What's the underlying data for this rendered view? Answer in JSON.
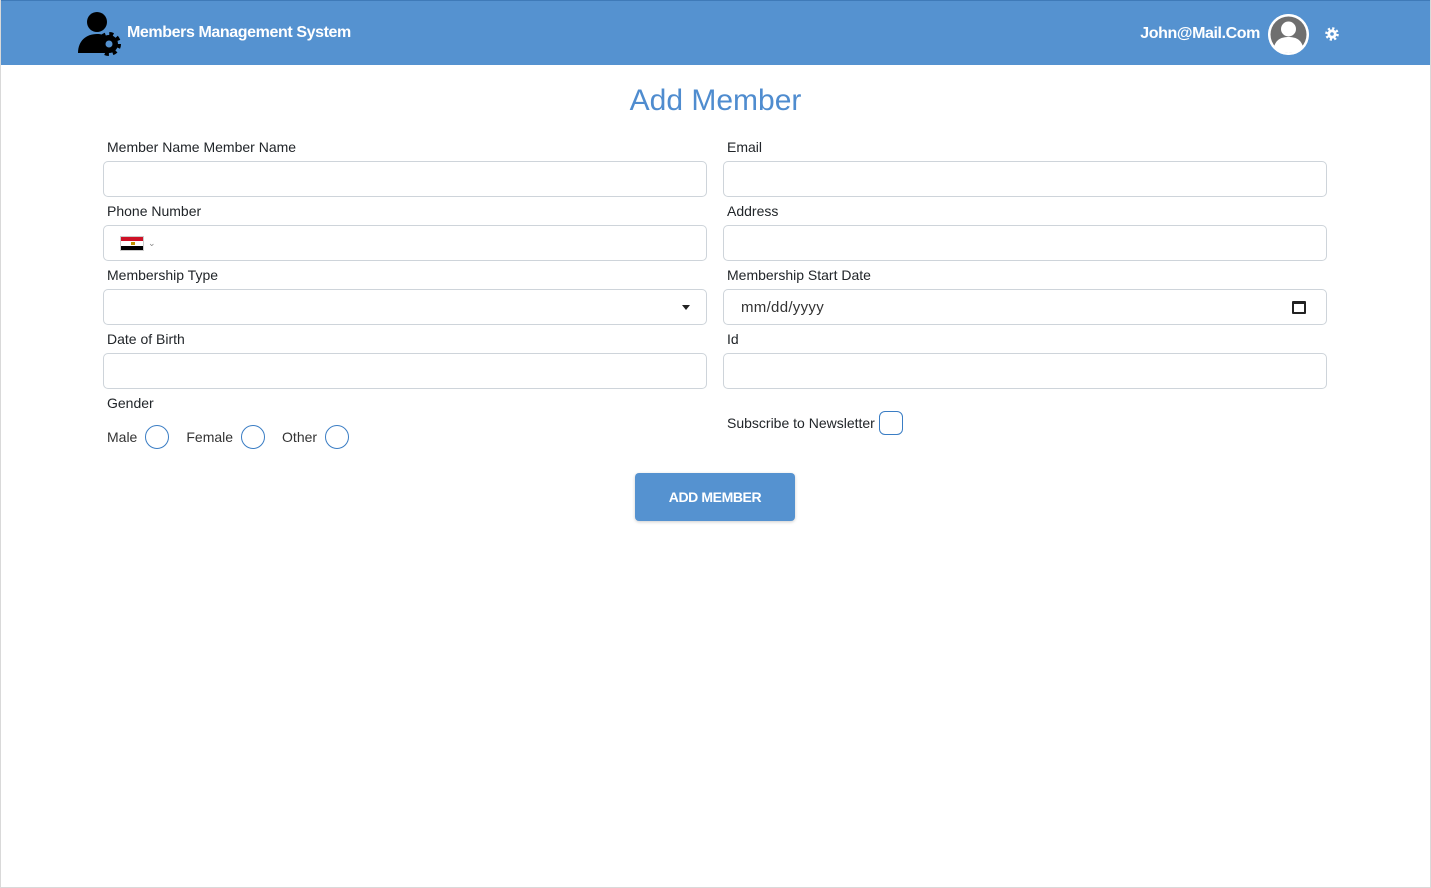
{
  "header": {
    "app_title": "Members Management System",
    "user_email": "John@Mail.Com",
    "color": "#5592d0"
  },
  "page_title": "Add Member",
  "form": {
    "member_name_label": "Member Name Member Name",
    "email_label": "Email",
    "phone_label": "Phone Number",
    "phone_country_flag": "egypt-flag",
    "address_label": "Address",
    "membership_type_label": "Membership Type",
    "membership_type_value": "",
    "membership_start_date_label": "Membership Start Date",
    "membership_start_date_placeholder": "mm/dd/yyyy",
    "dob_label": "Date of Birth",
    "id_label": "Id",
    "gender_label": "Gender",
    "gender_options": [
      "Male",
      "Female",
      "Other"
    ],
    "newsletter_label": "Subscribe to Newsletter",
    "submit_label": "ADD MEMBER"
  }
}
